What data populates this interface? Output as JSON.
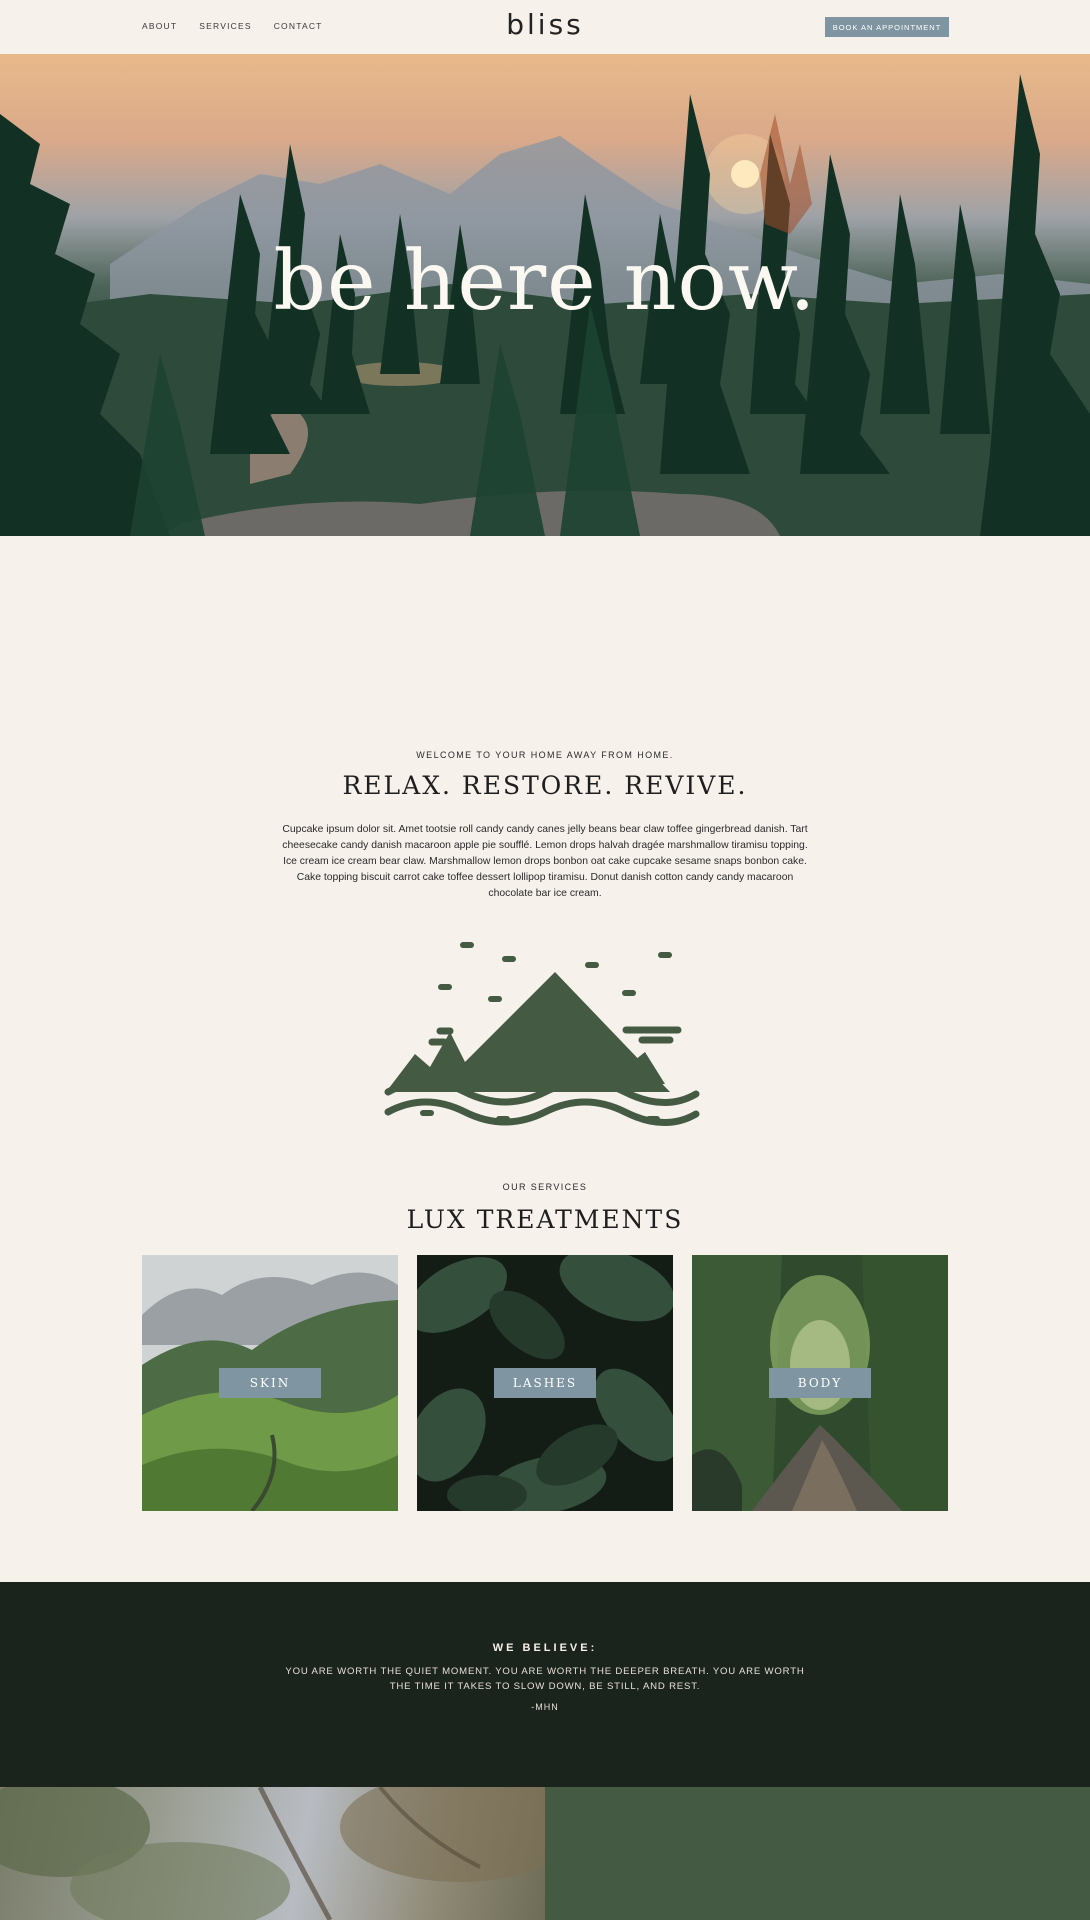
{
  "header": {
    "logo": "bliss",
    "nav": [
      "ABOUT",
      "SERVICES",
      "CONTACT"
    ],
    "book_button": "BOOK AN APPOINTMENT"
  },
  "hero": {
    "title": "be here now."
  },
  "intro": {
    "eyebrow": "WELCOME TO YOUR HOME AWAY FROM HOME.",
    "heading": "RELAX. RESTORE. REVIVE.",
    "paragraph": "Cupcake ipsum dolor sit. Amet tootsie roll candy candy canes jelly beans bear claw toffee gingerbread danish. Tart cheesecake candy danish macaroon apple pie soufflé. Lemon drops halvah dragée marshmallow tiramisu topping. Ice cream ice cream bear claw. Marshmallow lemon drops bonbon oat cake cupcake sesame snaps bonbon cake. Cake topping biscuit carrot cake toffee dessert lollipop tiramisu. Donut danish cotton candy candy macaroon chocolate bar ice cream."
  },
  "services": {
    "eyebrow": "OUR SERVICES",
    "heading": "LUX TREATMENTS",
    "cards": [
      {
        "label": "SKIN"
      },
      {
        "label": "LASHES"
      },
      {
        "label": "BODY"
      }
    ]
  },
  "believe": {
    "title": "WE BELIEVE:",
    "quote": "YOU ARE WORTH THE QUIET MOMENT. YOU ARE WORTH THE DEEPER BREATH. YOU ARE WORTH THE TIME IT TAKES TO SLOW DOWN, BE STILL, AND REST.",
    "author": "-MHN"
  },
  "colors": {
    "background": "#f6f1eb",
    "accent_green": "#445a43",
    "button_blue_gray": "#7f95a2",
    "dark_band": "#1b241c"
  },
  "icons": [
    "moon-icon",
    "mountain-icon"
  ]
}
